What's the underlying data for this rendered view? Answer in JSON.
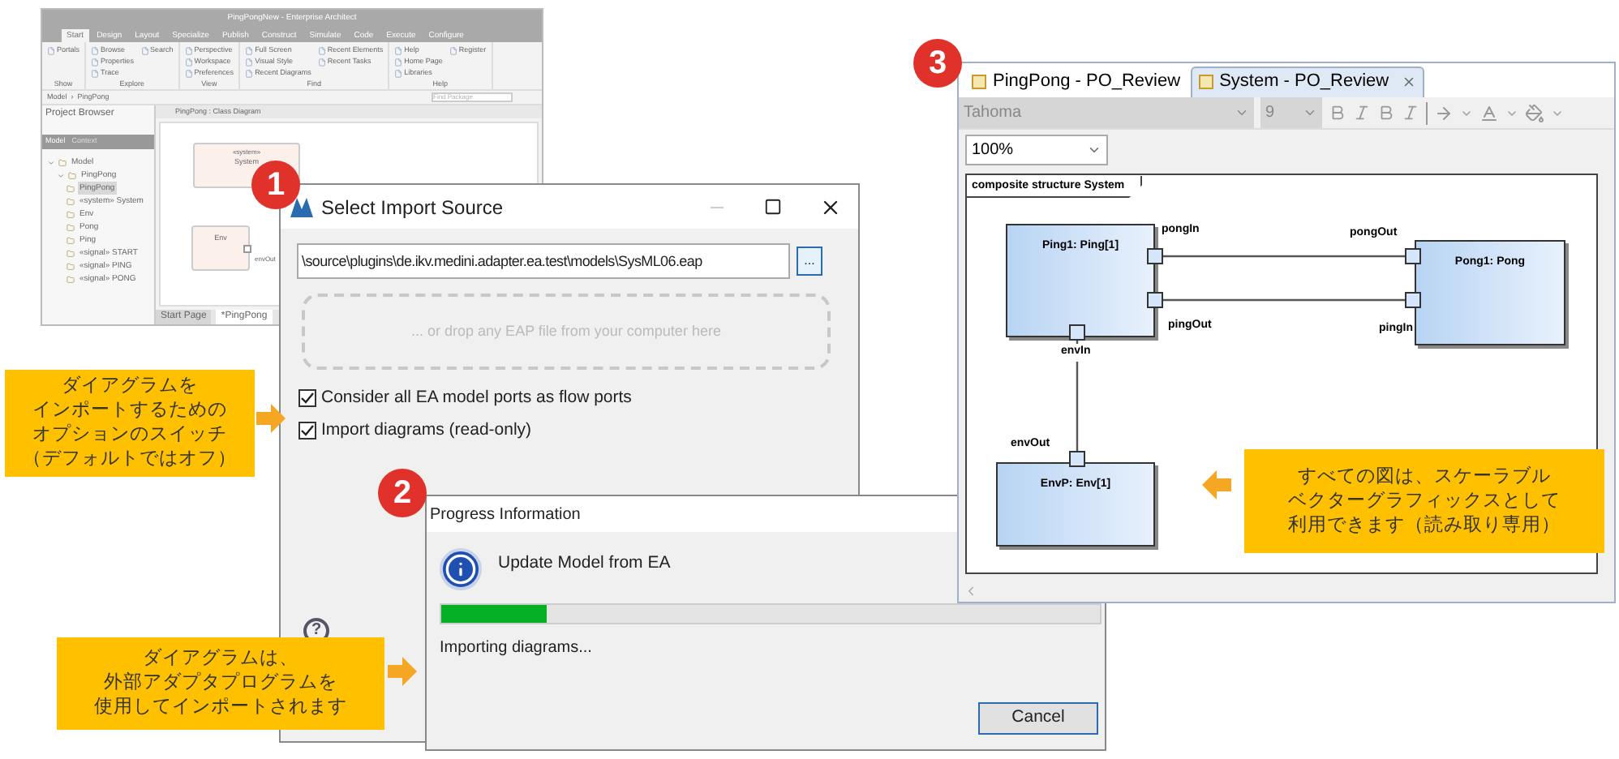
{
  "background_window": {
    "title": "PingPongNew - Enterprise Architect",
    "ribbon_tabs": [
      {
        "label": "Start",
        "selected": true
      },
      {
        "label": "Design",
        "selected": false
      },
      {
        "label": "Layout",
        "selected": false
      },
      {
        "label": "Specialize",
        "selected": false
      },
      {
        "label": "Publish",
        "selected": false
      },
      {
        "label": "Construct",
        "selected": false
      },
      {
        "label": "Simulate",
        "selected": false
      },
      {
        "label": "Code",
        "selected": false
      },
      {
        "label": "Execute",
        "selected": false
      },
      {
        "label": "Configure",
        "selected": false
      }
    ],
    "ribbon_groups": [
      {
        "label": "Show",
        "buttons": [
          "Portals"
        ]
      },
      {
        "label": "Explore",
        "buttons": [
          "Browse",
          "Properties",
          "Trace",
          "Search"
        ]
      },
      {
        "label": "View",
        "buttons": [
          "Perspective",
          "Workspace",
          "Preferences"
        ]
      },
      {
        "label": "Find",
        "buttons": [
          "Full Screen",
          "Visual Style",
          "Recent Diagrams",
          "Recent Elements",
          "Recent Tasks"
        ]
      },
      {
        "label": "Help",
        "buttons": [
          "Help",
          "Home Page",
          "Libraries",
          "Register"
        ]
      }
    ],
    "breadcrumb": "Model  ›  PingPong",
    "find_placeholder": "Find Package",
    "browser_title": "Project Browser",
    "browser_tabs": [
      {
        "label": "Model",
        "selected": true
      },
      {
        "label": "Context",
        "selected": false
      }
    ],
    "tree": [
      {
        "label": "Model",
        "expanded": true,
        "children": [
          {
            "label": "PingPong",
            "expanded": true,
            "children": [
              {
                "label": "PingPong",
                "selected": true
              },
              {
                "label": "«system» System",
                "selected": false
              },
              {
                "label": "Env",
                "selected": false
              },
              {
                "label": "Pong",
                "selected": false
              },
              {
                "label": "Ping",
                "selected": false
              },
              {
                "label": "«signal» START",
                "selected": false
              },
              {
                "label": "«signal» PING",
                "selected": false
              },
              {
                "label": "«signal» PONG",
                "selected": false
              }
            ]
          }
        ]
      }
    ],
    "diagram_tab": "PingPong : Class Diagram",
    "diagram_nodes": [
      {
        "stereotype": "«system»",
        "label": "System"
      },
      {
        "label": "Env",
        "port": "envOut"
      }
    ],
    "doc_tabs": [
      {
        "label": "Start Page",
        "selected": false
      },
      {
        "label": "*PingPong",
        "selected": true
      }
    ]
  },
  "import_dialog": {
    "badge": "1",
    "title": "Select Import Source",
    "path": "\\source\\plugins\\de.ikv.medini.adapter.ea.test\\models\\SysML06.eap",
    "browse": "...",
    "drop_hint": "... or drop any EAP file from your computer here",
    "options": [
      {
        "label": "Consider all EA model ports as flow ports",
        "checked": true
      },
      {
        "label": "Import diagrams (read-only)",
        "checked": true
      }
    ],
    "help": "?"
  },
  "progress_dialog": {
    "badge": "2",
    "title": "Progress Information",
    "message": "Update Model from EA",
    "level": 0.16,
    "status": "Importing diagrams...",
    "cancel": "Cancel"
  },
  "editor": {
    "badge": "3",
    "tabs": [
      {
        "label": "PingPong - PO_Review",
        "selected": false
      },
      {
        "label": "System - PO_Review",
        "selected": true
      }
    ],
    "font": "Tahoma",
    "font_size": "9",
    "zoom": "100%",
    "frame_title": "composite structure System",
    "parts": [
      {
        "label": "Ping1: Ping[1]"
      },
      {
        "label": "Pong1: Pong"
      },
      {
        "label": "EnvP: Env[1]"
      }
    ],
    "ports": [
      {
        "label": "pongIn"
      },
      {
        "label": "pongOut"
      },
      {
        "label": "pingOut"
      },
      {
        "label": "pingIn"
      },
      {
        "label": "envIn"
      },
      {
        "label": "envOut"
      }
    ]
  },
  "callouts": [
    {
      "lines": [
        "ダイアグラムを",
        "インポートするための",
        "オプションのスイッチ",
        "（デフォルトではオフ）"
      ]
    },
    {
      "lines": [
        "ダイアグラムは、",
        "外部アダプタプログラムを",
        "使用してインポートされます"
      ]
    },
    {
      "lines": [
        "すべての図は、スケーラブル",
        "ベクターグラフィックスとして",
        "利用できます（読み取り専用）"
      ]
    }
  ]
}
